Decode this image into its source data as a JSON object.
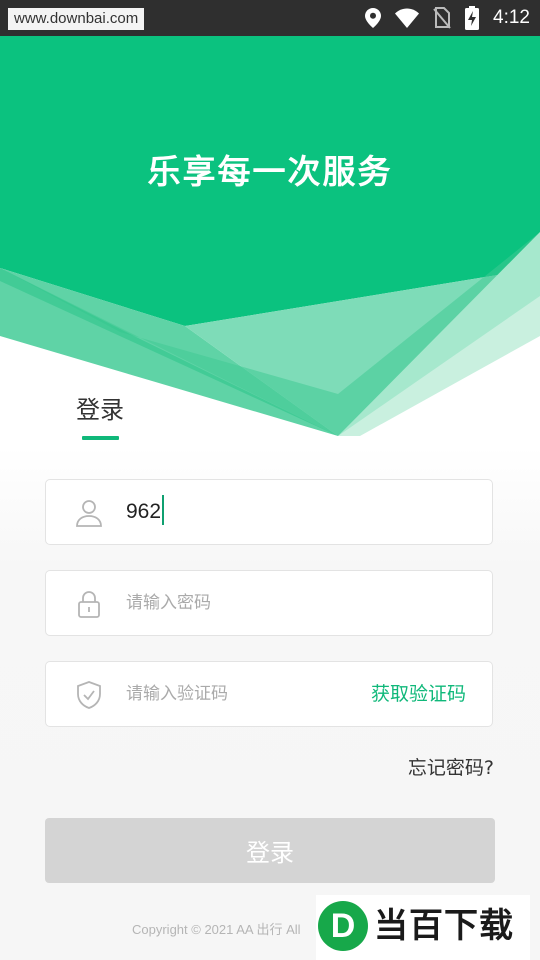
{
  "status_bar": {
    "url_watermark": "www.downbai.com",
    "time": "4:12",
    "icons": [
      "location-icon",
      "wifi-icon",
      "no-sim-icon",
      "battery-charging-icon"
    ]
  },
  "header": {
    "slogan": "乐享每一次服务",
    "brand_color": "#0bc27f"
  },
  "tabs": {
    "active": "登录"
  },
  "form": {
    "phone": {
      "value": "962",
      "icon": "user-icon"
    },
    "password": {
      "placeholder": "请输入密码",
      "icon": "lock-icon"
    },
    "verify_code": {
      "placeholder": "请输入验证码",
      "icon": "shield-check-icon",
      "get_code_label": "获取验证码"
    },
    "forgot_label": "忘记密码?",
    "submit_label": "登录"
  },
  "footer": {
    "copyright": "Copyright © 2021 AA 出行 All",
    "site_logo_letter": "D",
    "site_logo_text": "当百下载"
  },
  "colors": {
    "accent": "#10b87a",
    "button_disabled": "#d4d4d4",
    "placeholder": "#aaaaaa"
  }
}
